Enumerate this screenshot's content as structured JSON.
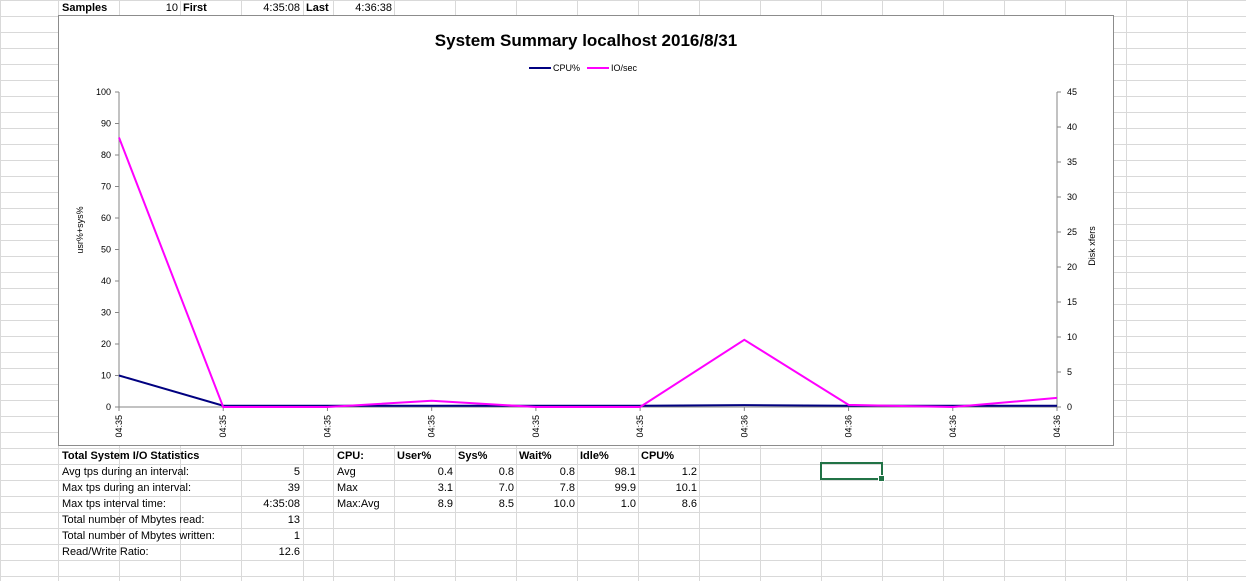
{
  "header": {
    "samples_label": "Samples",
    "samples_value": "10",
    "first_label": "First",
    "first_value": "4:35:08",
    "last_label": "Last",
    "last_value": "4:36:38"
  },
  "chart_data": {
    "type": "line",
    "title": "System Summary localhost  2016/8/31",
    "categories": [
      "04:35",
      "04:35",
      "04:35",
      "04:35",
      "04:35",
      "04:35",
      "04:36",
      "04:36",
      "04:36",
      "04:36"
    ],
    "series": [
      {
        "name": "CPU%",
        "axis": "left",
        "color": "#000080",
        "values": [
          10,
          0.4,
          0.4,
          0.4,
          0.4,
          0.4,
          0.6,
          0.4,
          0.4,
          0.4
        ]
      },
      {
        "name": "IO/sec",
        "axis": "right",
        "color": "#ff00ff",
        "values": [
          38.5,
          0,
          0,
          0.9,
          0,
          0,
          9.6,
          0.3,
          0,
          1.3
        ]
      }
    ],
    "ylabel": "usr%+sys%",
    "ylabel_right": "Disk xfers",
    "ylim": [
      0,
      100
    ],
    "ylim_right": [
      0,
      45
    ],
    "yticks": [
      "0",
      "10",
      "20",
      "30",
      "40",
      "50",
      "60",
      "70",
      "80",
      "90",
      "100"
    ],
    "yticks_right": [
      "0",
      "5",
      "10",
      "15",
      "20",
      "25",
      "30",
      "35",
      "40",
      "45"
    ],
    "legend_position": "top-center",
    "grid": false
  },
  "io_stats": {
    "title": "Total System I/O Statistics",
    "rows": [
      {
        "label": "Avg tps during an interval:",
        "value": "5"
      },
      {
        "label": "Max tps during an interval:",
        "value": "39"
      },
      {
        "label": "Max tps interval time:",
        "value": "4:35:08"
      },
      {
        "label": "Total number of Mbytes read:",
        "value": "13"
      },
      {
        "label": "Total number of Mbytes written:",
        "value": "1"
      },
      {
        "label": "Read/Write Ratio:",
        "value": "12.6"
      }
    ]
  },
  "cpu_table": {
    "headers": [
      "CPU:",
      "User%",
      "Sys%",
      "Wait%",
      "Idle%",
      "CPU%"
    ],
    "rows": [
      {
        "label": "Avg",
        "values": [
          "0.4",
          "0.8",
          "0.8",
          "98.1",
          "1.2"
        ]
      },
      {
        "label": "Max",
        "values": [
          "3.1",
          "7.0",
          "7.8",
          "99.9",
          "10.1"
        ]
      },
      {
        "label": "Max:Avg",
        "values": [
          "8.9",
          "8.5",
          "10.0",
          "1.0",
          "8.6"
        ]
      }
    ]
  }
}
